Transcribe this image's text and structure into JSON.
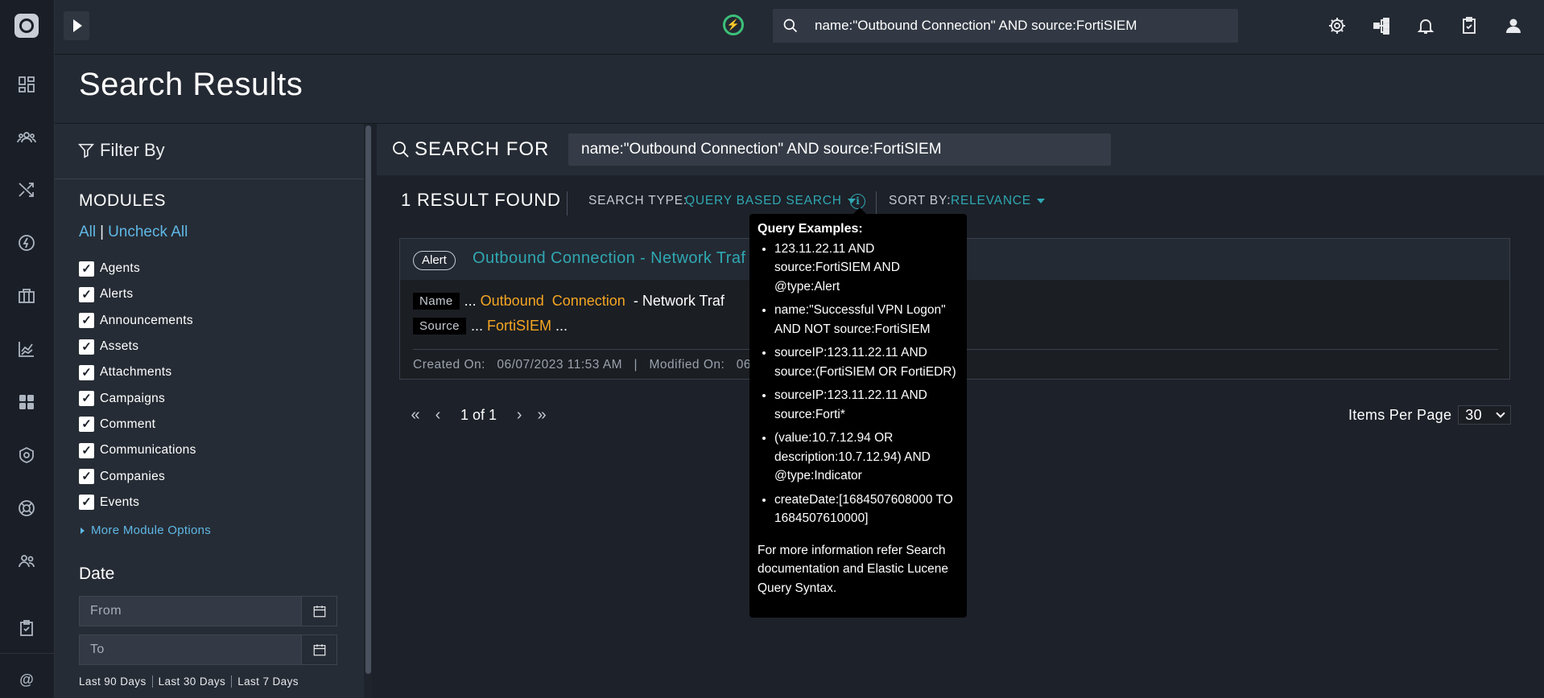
{
  "page": {
    "title": "Search Results"
  },
  "topbar": {
    "search_value": "name:\"Outbound Connection\" AND source:FortiSIEM"
  },
  "nav": {
    "items": [
      "dashboard",
      "users",
      "shuffle",
      "bolt",
      "briefcase",
      "chart",
      "apps",
      "shield",
      "lifebuoy",
      "people",
      "clipboard",
      "at"
    ]
  },
  "filter": {
    "title": "Filter By",
    "modules_heading": "MODULES",
    "all_label": "All",
    "separator": "|",
    "uncheck_all_label": "Uncheck All",
    "modules": [
      {
        "label": "Agents",
        "checked": true
      },
      {
        "label": "Alerts",
        "checked": true
      },
      {
        "label": "Announcements",
        "checked": true
      },
      {
        "label": "Assets",
        "checked": true
      },
      {
        "label": "Attachments",
        "checked": true
      },
      {
        "label": "Campaigns",
        "checked": true
      },
      {
        "label": "Comment",
        "checked": true
      },
      {
        "label": "Communications",
        "checked": true
      },
      {
        "label": "Companies",
        "checked": true
      },
      {
        "label": "Events",
        "checked": true
      }
    ],
    "more_options": "More Module Options",
    "date_heading": "Date",
    "from_placeholder": "From",
    "to_placeholder": "To",
    "quick_ranges": [
      "Last 90 Days",
      "Last 30 Days",
      "Last 7 Days"
    ]
  },
  "search": {
    "label": "SEARCH FOR",
    "value": "name:\"Outbound Connection\" AND source:FortiSIEM",
    "result_count": "1 RESULT FOUND",
    "search_type_label": "SEARCH TYPE:",
    "search_type_value": "QUERY BASED SEARCH",
    "sort_label": "SORT BY:",
    "sort_value": "RELEVANCE"
  },
  "result": {
    "badge": "Alert",
    "title": "Outbound Connection - Network Traf",
    "name_tag": "Name",
    "name_prefix": "...",
    "name_hl1": "Outbound",
    "name_hl2": "Connection",
    "name_rest": "- Network Traf",
    "source_tag": "Source",
    "source_prefix": "...",
    "source_hl": "FortiSIEM",
    "source_suffix": "...",
    "created_label": "Created On:",
    "created_value": "06/07/2023 11:53 AM",
    "meta_sep": "|",
    "modified_label": "Modified On:",
    "modified_value": "06"
  },
  "pagination": {
    "page_text": "1 of 1",
    "items_per_page_label": "Items Per Page",
    "items_per_page_value": "30"
  },
  "tooltip": {
    "heading": "Query Examples:",
    "examples": [
      "123.11.22.11 AND source:FortiSIEM AND @type:Alert",
      "name:\"Successful VPN Logon\" AND NOT source:FortiSIEM",
      "sourceIP:123.11.22.11 AND source:(FortiSIEM OR FortiEDR)",
      "sourceIP:123.11.22.11 AND source:Forti*",
      "(value:10.7.12.94 OR description:10.7.12.94) AND @type:Indicator",
      "createDate:[1684507608000 TO 1684507610000]"
    ],
    "footer": "For more information refer Search documentation and Elastic Lucene Query Syntax."
  },
  "colors": {
    "accent_teal": "#2fa8b3",
    "link_blue": "#5fb8e6",
    "highlight_orange": "#f5a623",
    "status_green": "#3cc07a"
  }
}
